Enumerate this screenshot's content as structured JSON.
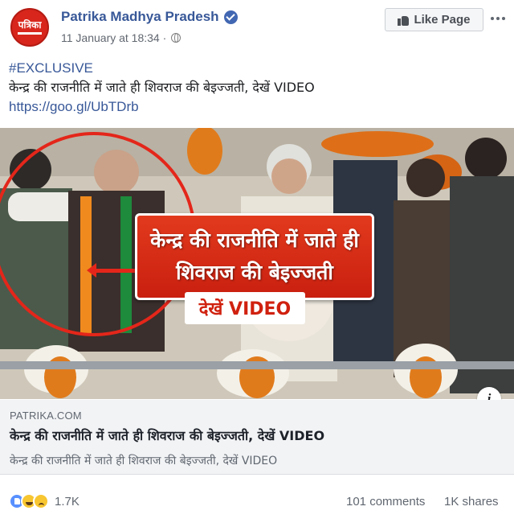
{
  "header": {
    "avatar_text": "पत्रिका",
    "page_name": "Patrika Madhya Pradesh",
    "timestamp": "11 January at 18:34 ·",
    "like_button_label": "Like Page"
  },
  "post": {
    "hashtag": "#EXCLUSIVE",
    "headline": "केन्द्र की राजनीति में जाते ही शिवराज की बेइज्जती, देखें VIDEO",
    "link": "https://goo.gl/UbTDrb"
  },
  "image": {
    "overlay_line1": "केन्द्र की राजनीति में जाते ही",
    "overlay_line2": "शिवराज की बेइज्जती",
    "overlay_tag": "देखें VIDEO",
    "info_label": "i"
  },
  "preview": {
    "domain": "PATRIKA.COM",
    "title": "केन्द्र की राजनीति में जाते ही शिवराज की बेइज्जती, देखें VIDEO",
    "description": "केन्द्र की राजनीति में जाते ही शिवराज की बेइज्जती, देखें VIDEO"
  },
  "footer": {
    "reaction_icons": [
      "like-icon",
      "haha-icon",
      "sad-icon"
    ],
    "reaction_count": "1.7K",
    "comments": "101 comments",
    "shares": "1K shares"
  },
  "colors": {
    "link_blue": "#385898",
    "overlay_red": "#d0210f",
    "preview_bg": "#f2f3f5"
  }
}
